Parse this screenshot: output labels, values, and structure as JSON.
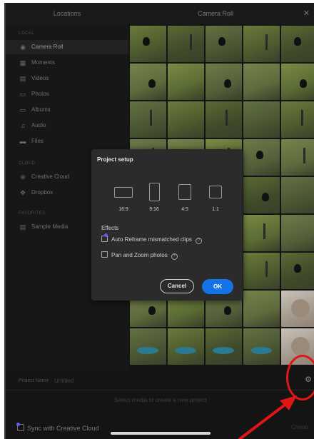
{
  "header": {
    "left_title": "Locations",
    "center_title": "Camera Roll",
    "close_glyph": "✕"
  },
  "sidebar": {
    "sections": [
      {
        "label": "LOCAL",
        "items": [
          {
            "icon": "camera-roll-icon",
            "glyph": "◉",
            "label": "Camera Roll",
            "active": true
          },
          {
            "icon": "moments-icon",
            "glyph": "▦",
            "label": "Moments"
          },
          {
            "icon": "videos-icon",
            "glyph": "▤",
            "label": "Videos"
          },
          {
            "icon": "photos-icon",
            "glyph": "▭",
            "label": "Photos"
          },
          {
            "icon": "albums-icon",
            "glyph": "▭",
            "label": "Albums"
          },
          {
            "icon": "audio-icon",
            "glyph": "♫",
            "label": "Audio"
          },
          {
            "icon": "files-icon",
            "glyph": "▬",
            "label": "Files"
          }
        ]
      },
      {
        "label": "CLOUD",
        "items": [
          {
            "icon": "creative-cloud-icon",
            "glyph": "⊕",
            "label": "Creative Cloud"
          },
          {
            "icon": "dropbox-icon",
            "glyph": "✥",
            "label": "Dropbox"
          }
        ]
      },
      {
        "label": "FAVORITES",
        "items": [
          {
            "icon": "sample-media-icon",
            "glyph": "▤",
            "label": "Sample Media"
          }
        ]
      }
    ]
  },
  "dialog": {
    "title": "Project setup",
    "ratios": [
      {
        "label": "16:9",
        "icon": "landscape-ratio-icon"
      },
      {
        "label": "9:16",
        "icon": "portrait-ratio-icon"
      },
      {
        "label": "4:5",
        "icon": "four-five-ratio-icon"
      },
      {
        "label": "1:1",
        "icon": "square-ratio-icon"
      }
    ],
    "effects_label": "Effects",
    "options": [
      {
        "label": "Auto Reframe mismatched clips",
        "checked": false
      },
      {
        "label": "Pan and Zoom photos",
        "checked": false
      }
    ],
    "cancel_label": "Cancel",
    "ok_label": "OK"
  },
  "bottom": {
    "project_name_label": "Project Name",
    "project_name_placeholder": "Untitled",
    "hint": "Select media to create a new project",
    "sync_label": "Sync with Creative Cloud",
    "create_label": "Create",
    "settings_icon": "gear-icon"
  },
  "colors": {
    "accent": "#1473e6",
    "annotation": "#e01515",
    "background": "#151515"
  }
}
